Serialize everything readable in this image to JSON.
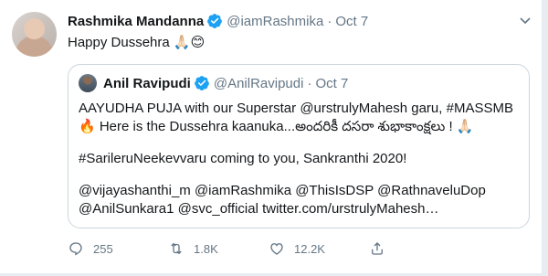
{
  "tweet": {
    "author_name": "Rashmika Mandanna",
    "author_handle": "@iamRashmika",
    "separator": "·",
    "date": "Oct 7",
    "text": "Happy Dussehra",
    "emojis": "🙏🏻😊"
  },
  "quoted": {
    "author_name": "Anil Ravipudi",
    "author_handle": "@AnilRavipudi",
    "separator": "·",
    "date": "Oct 7",
    "lines": [
      "AAYUDHA PUJA with our Superstar @urstrulyMahesh garu, #MASSMB",
      "🔥 Here is the Dussehra kaanuka...అందరికీ దసరా శుభాకాంక్షలు ! 🙏🏻",
      "",
      "#SarileruNeekevvaru coming to you, Sankranthi 2020!",
      "",
      "@vijayashanthi_m @iamRashmika @ThisIsDSP @RathnaveluDop",
      "@AnilSunkara1 @svc_official twitter.com/urstrulyMahesh…"
    ]
  },
  "actions": {
    "reply_count": "255",
    "retweet_count": "1.8K",
    "like_count": "12.2K"
  },
  "colors": {
    "text": "#14171a",
    "secondary": "#657786",
    "verified": "#1da1f2",
    "border": "#ccd6dd",
    "background": "#e6ecf0"
  },
  "icons": [
    "verified-badge-icon",
    "caret-down-icon",
    "reply-icon",
    "retweet-icon",
    "like-icon",
    "share-icon"
  ]
}
